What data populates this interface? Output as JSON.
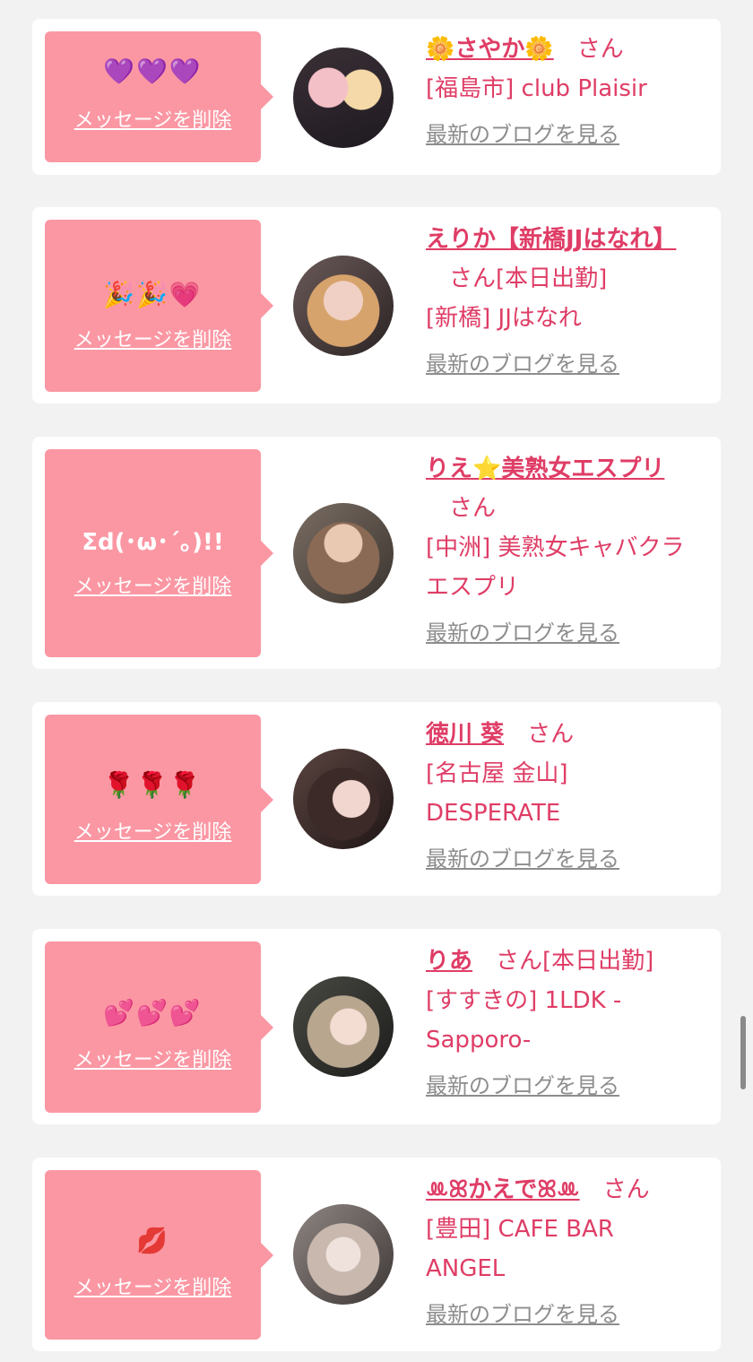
{
  "delete_label": "メッセージを削除",
  "blog_label": "最新のブログを見る",
  "honorific": "さん",
  "colors": {
    "accent": "#df3d66",
    "bubble": "#fb97a3",
    "link_gray": "#8d8d8d"
  },
  "cards": [
    {
      "message": "💜💜💜",
      "name": "🌼さやか🌼",
      "status": "",
      "shop": "[福島市] club Plaisir"
    },
    {
      "message": "🎉🎉💗",
      "name": "えりか【新橋JJはなれ】",
      "status": "[本日出勤]",
      "shop": "[新橋] JJはなれ"
    },
    {
      "message": "Σd(･ω･´｡)!!",
      "name": "りえ⭐美熟女エスプリ",
      "status": "",
      "shop": "[中洲] 美熟女キャバクラ エスプリ"
    },
    {
      "message": "🌹🌹🌹",
      "name": "徳川 葵",
      "status": "",
      "shop": "[名古屋 金山] DESPERATE"
    },
    {
      "message": "💕💕💕",
      "name": "りあ",
      "status": "[本日出勤]",
      "shop": "[すすきの] 1LDK -Sapporo-"
    },
    {
      "message": "💋",
      "name": "ꔛꕤかえでꕤꔛ",
      "status": "",
      "shop": "[豊田] CAFE BAR ANGEL"
    }
  ]
}
